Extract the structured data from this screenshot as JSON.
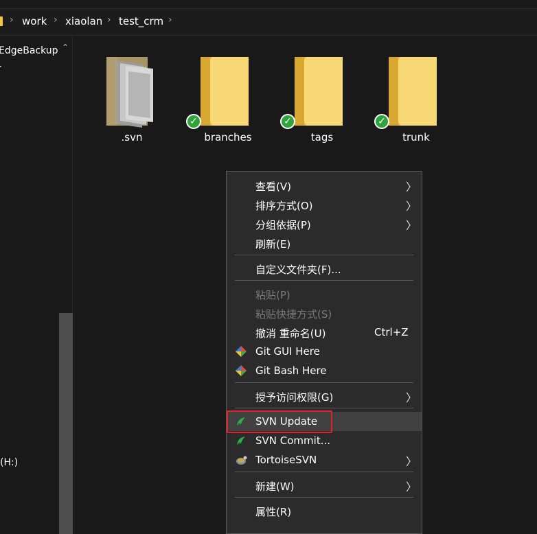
{
  "breadcrumb": {
    "items": [
      "work",
      "xiaolan",
      "test_crm"
    ],
    "separator": "›"
  },
  "navpane": {
    "item_top": "EdgeBackup",
    "item_drive": "(H:)"
  },
  "files": [
    {
      "name": ".svn",
      "icon": "svn-folder-icon",
      "status": ""
    },
    {
      "name": "branches",
      "icon": "folder-icon",
      "status": "svn-normal"
    },
    {
      "name": "tags",
      "icon": "folder-icon",
      "status": "svn-normal"
    },
    {
      "name": "trunk",
      "icon": "folder-icon",
      "status": "svn-normal"
    }
  ],
  "menu": {
    "view": "查看(V)",
    "sort": "排序方式(O)",
    "group": "分组依据(P)",
    "refresh": "刷新(E)",
    "customize": "自定义文件夹(F)...",
    "paste": "粘贴(P)",
    "paste_shortcut": "粘贴快捷方式(S)",
    "undo_rename": "撤消 重命名(U)",
    "undo_shortcut": "Ctrl+Z",
    "git_gui": "Git GUI Here",
    "git_bash": "Git Bash Here",
    "grant_access": "授予访问权限(G)",
    "svn_update": "SVN Update",
    "svn_commit": "SVN Commit...",
    "tortoise": "TortoiseSVN",
    "new": "新建(W)",
    "properties": "属性(R)"
  },
  "colors": {
    "background": "#191919",
    "menu_bg": "#2b2b2b",
    "highlight_border": "#e5202d",
    "folder": "#f5c542",
    "check": "#2ea43a"
  }
}
